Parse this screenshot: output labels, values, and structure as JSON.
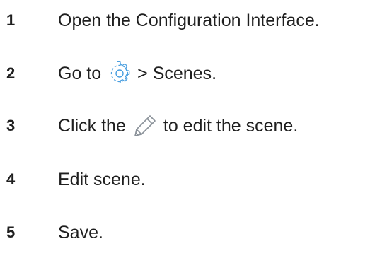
{
  "steps": [
    {
      "number": "1",
      "text": "Open the Configuration Interface."
    },
    {
      "number": "2",
      "text_before": "Go to",
      "icon": "gear-icon",
      "text_after": "> Scenes."
    },
    {
      "number": "3",
      "text_before": "Click the",
      "icon": "pencil-icon",
      "text_after": "to edit the scene."
    },
    {
      "number": "4",
      "text": "Edit scene."
    },
    {
      "number": "5",
      "text": "Save."
    }
  ],
  "colors": {
    "text": "#1f1f1f",
    "icon_blue": "#4a9fe0",
    "icon_gray": "#8a9199"
  }
}
